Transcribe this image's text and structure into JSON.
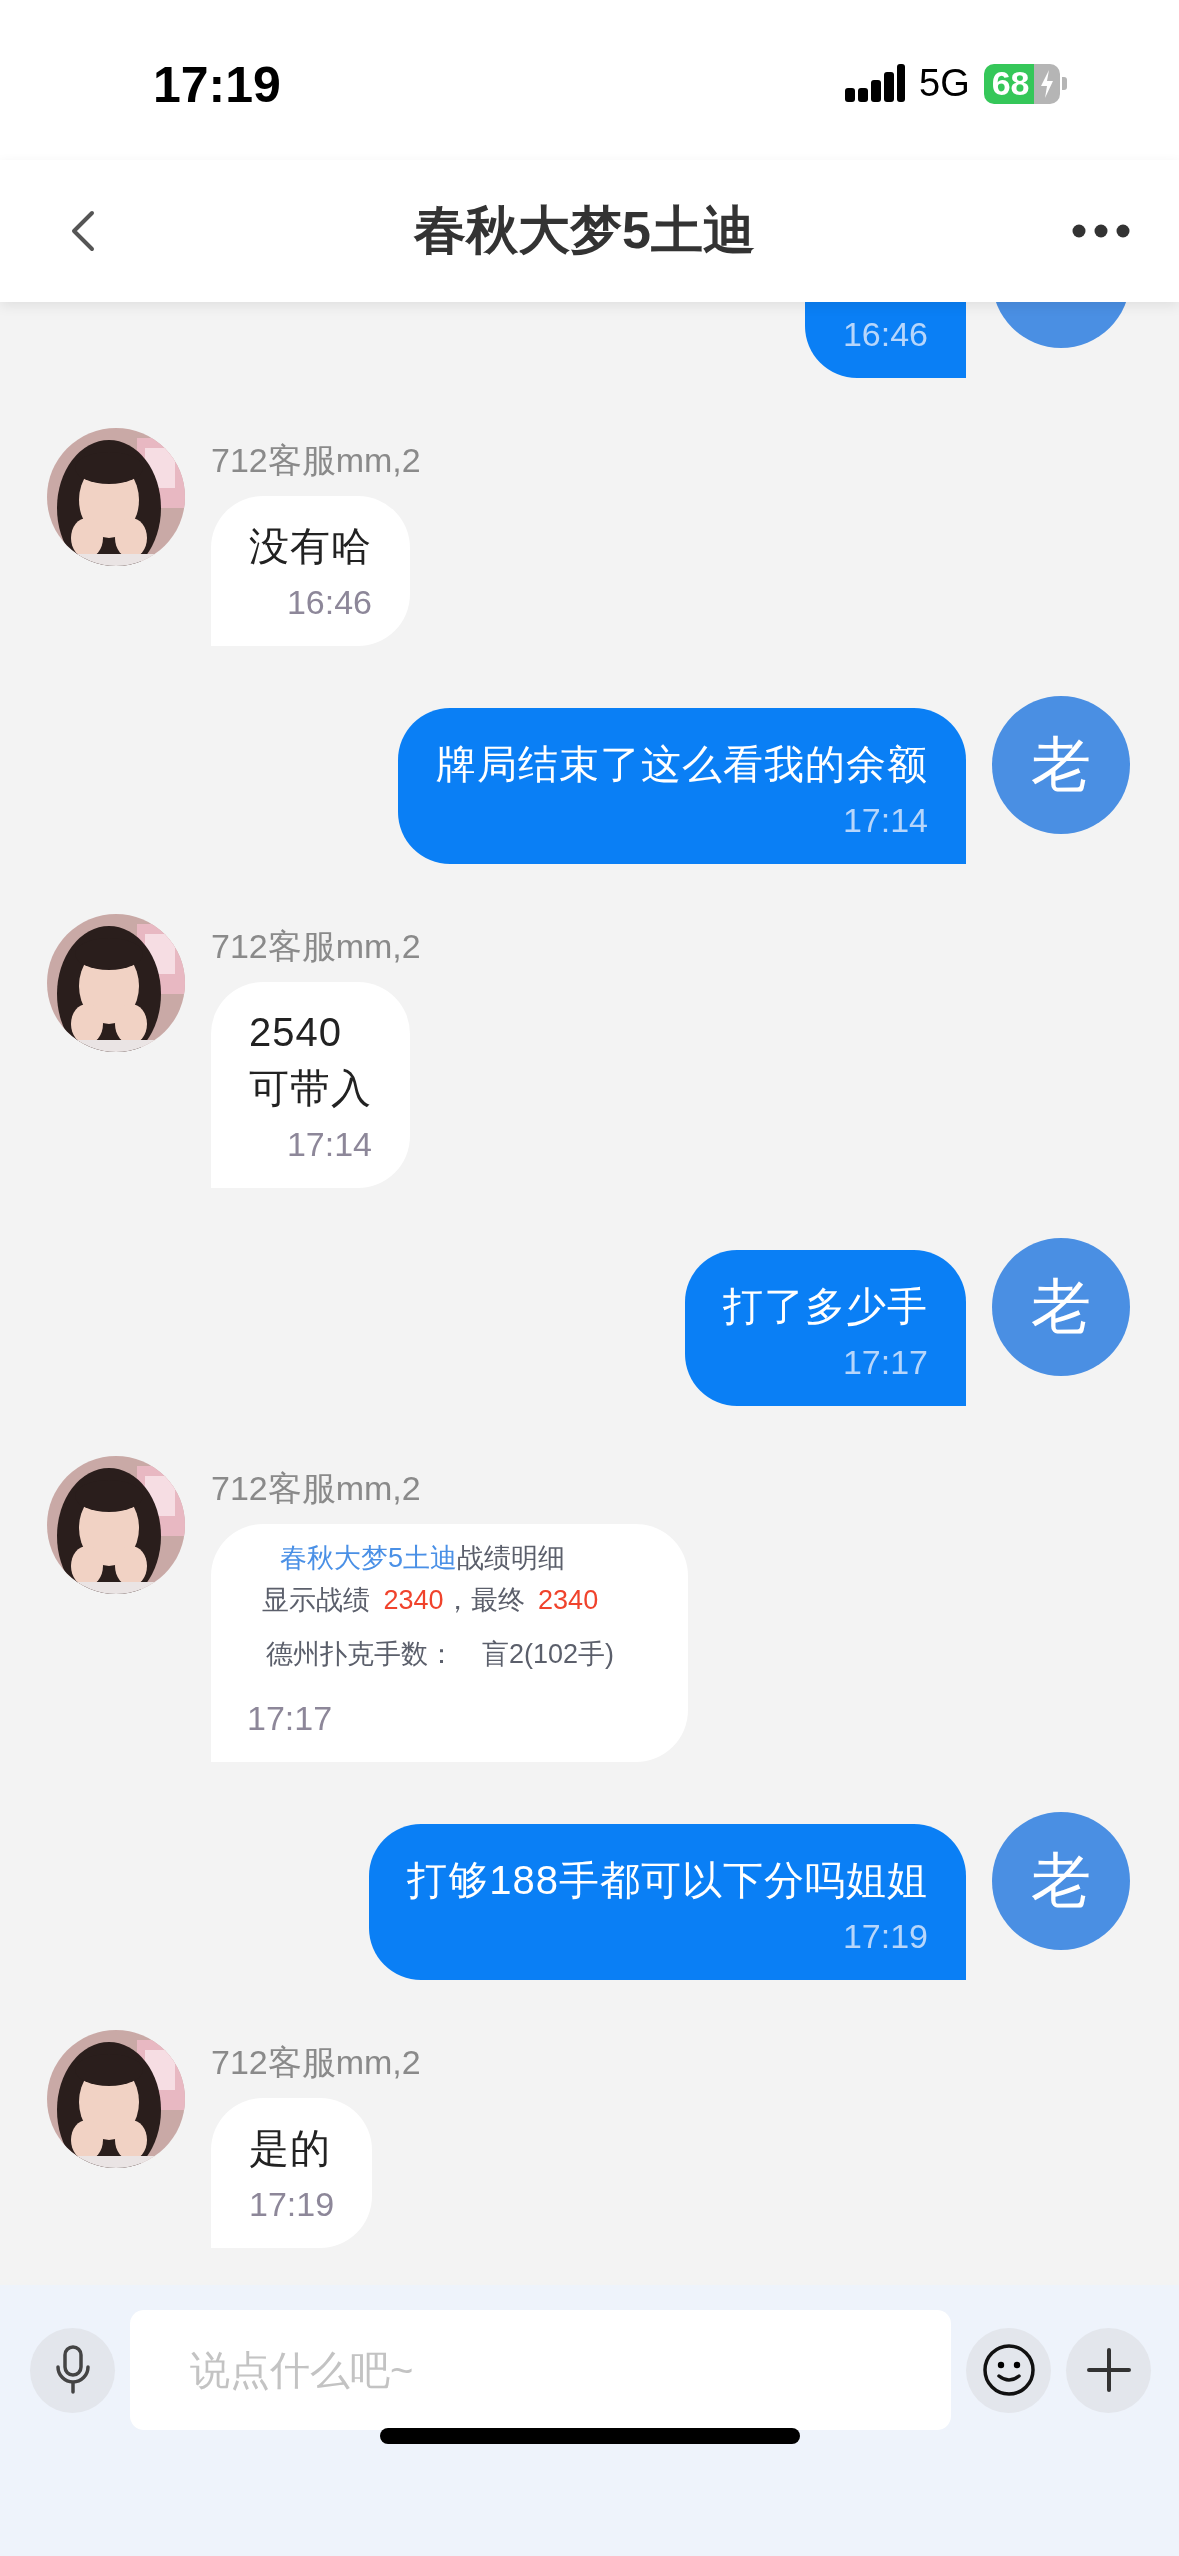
{
  "status_bar": {
    "time": "17:19",
    "network": "5G",
    "battery": "68"
  },
  "header": {
    "title": "春秋大梦5土迪"
  },
  "messages": [
    {
      "kind": "outgoing",
      "time": "16:46"
    },
    {
      "kind": "incoming",
      "sender": "712客服mm,2",
      "text": "没有哈",
      "time": "16:46"
    },
    {
      "kind": "outgoing",
      "avatar_text": "老",
      "text": "牌局结束了这么看我的余额",
      "time": "17:14"
    },
    {
      "kind": "incoming",
      "sender": "712客服mm,2",
      "text": "2540\n可带入",
      "time": "17:14"
    },
    {
      "kind": "outgoing",
      "avatar_text": "老",
      "text": "打了多少手",
      "time": "17:17"
    },
    {
      "kind": "card",
      "sender": "712客服mm,2",
      "card": {
        "title_highlight": "春秋大梦5土迪",
        "title": "战绩明细",
        "score_label": "显示战绩",
        "score": "2340",
        "final_label": "，最终",
        "final_score": "2340",
        "hands_label": "德州扑克手数：",
        "hands": "盲2(102手)"
      },
      "time": "17:17"
    },
    {
      "kind": "outgoing",
      "avatar_text": "老",
      "text": "打够188手都可以下分吗姐姐",
      "time": "17:19"
    },
    {
      "kind": "incoming",
      "sender": "712客服mm,2",
      "text": "是的",
      "time": "17:19"
    }
  ],
  "composer": {
    "placeholder": "说点什么吧~"
  }
}
